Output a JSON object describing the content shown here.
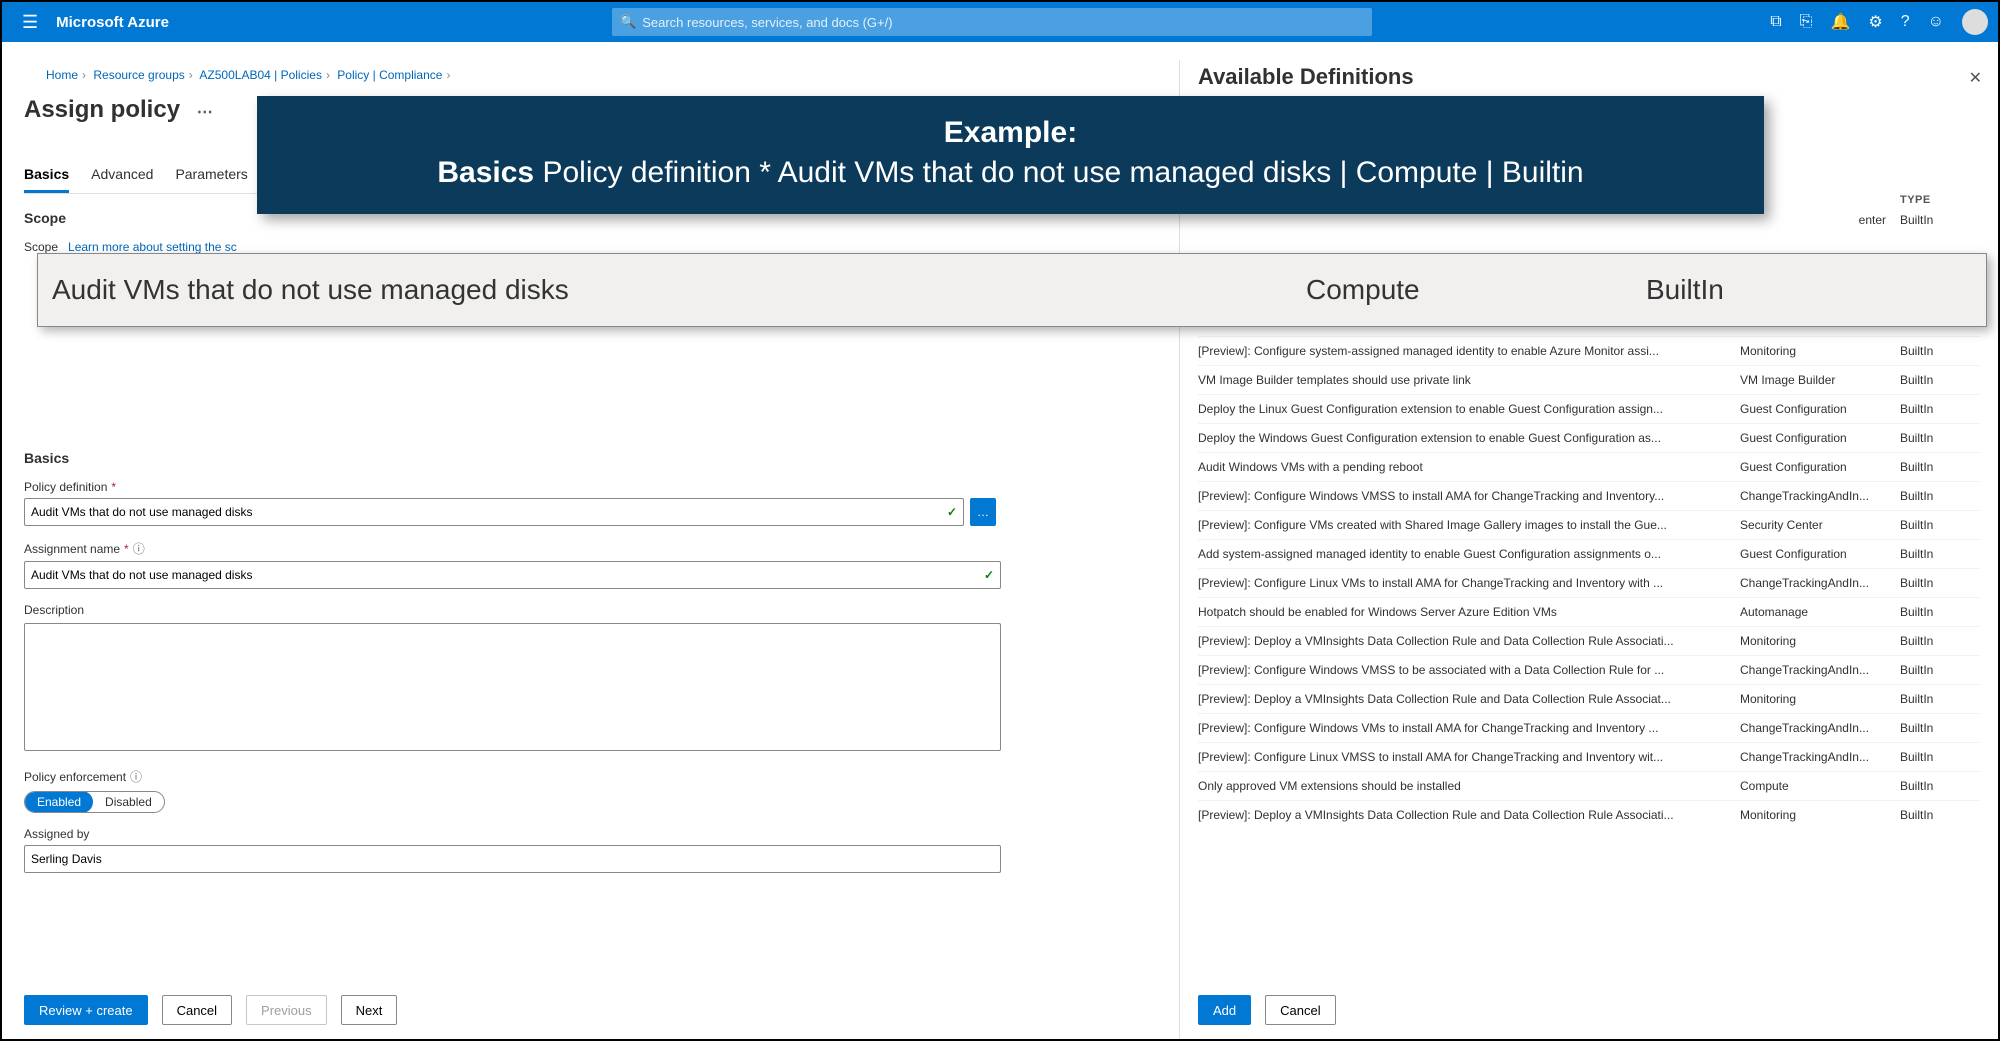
{
  "brand": "Microsoft Azure",
  "search_placeholder": "Search resources, services, and docs (G+/)",
  "breadcrumb": [
    "Home",
    "Resource groups",
    "AZ500LAB04 | Policies",
    "Policy | Compliance"
  ],
  "page_title": "Assign policy",
  "tabs": [
    "Basics",
    "Advanced",
    "Parameters"
  ],
  "scope_section": "Scope",
  "scope_label": "Scope",
  "scope_hint": "Learn more about setting the sc",
  "basics_section": "Basics",
  "policy_def_label": "Policy definition",
  "policy_def_value": "Audit VMs that do not use managed disks",
  "assignment_label": "Assignment name",
  "assignment_value": "Audit VMs that do not use managed disks",
  "description_label": "Description",
  "enforcement_label": "Policy enforcement",
  "toggle": {
    "enabled": "Enabled",
    "disabled": "Disabled"
  },
  "assigned_by_label": "Assigned by",
  "assigned_by_value": "Serling Davis",
  "footer": {
    "review": "Review + create",
    "cancel": "Cancel",
    "previous": "Previous",
    "next": "Next"
  },
  "right": {
    "title": "Available Definitions",
    "col_type": "TYPE",
    "add": "Add",
    "cancel": "Cancel"
  },
  "first_row_truncated": {
    "cat_suffix": "enter",
    "type": "BuiltIn"
  },
  "definitions": [
    {
      "name": "[Preview]: Configure system-assigned managed identity to enable Azure Monitor assi...",
      "category": "Monitoring",
      "type": "BuiltIn"
    },
    {
      "name": "VM Image Builder templates should use private link",
      "category": "VM Image Builder",
      "type": "BuiltIn"
    },
    {
      "name": "Deploy the Linux Guest Configuration extension to enable Guest Configuration assign...",
      "category": "Guest Configuration",
      "type": "BuiltIn"
    },
    {
      "name": "Deploy the Windows Guest Configuration extension to enable Guest Configuration as...",
      "category": "Guest Configuration",
      "type": "BuiltIn"
    },
    {
      "name": "Audit Windows VMs with a pending reboot",
      "category": "Guest Configuration",
      "type": "BuiltIn"
    },
    {
      "name": "[Preview]: Configure Windows VMSS to install AMA for ChangeTracking and Inventory...",
      "category": "ChangeTrackingAndIn...",
      "type": "BuiltIn"
    },
    {
      "name": "[Preview]: Configure VMs created with Shared Image Gallery images to install the Gue...",
      "category": "Security Center",
      "type": "BuiltIn"
    },
    {
      "name": "Add system-assigned managed identity to enable Guest Configuration assignments o...",
      "category": "Guest Configuration",
      "type": "BuiltIn"
    },
    {
      "name": "[Preview]: Configure Linux VMs to install AMA for ChangeTracking and Inventory with ...",
      "category": "ChangeTrackingAndIn...",
      "type": "BuiltIn"
    },
    {
      "name": "Hotpatch should be enabled for Windows Server Azure Edition VMs",
      "category": "Automanage",
      "type": "BuiltIn"
    },
    {
      "name": "[Preview]: Deploy a VMInsights Data Collection Rule and Data Collection Rule Associati...",
      "category": "Monitoring",
      "type": "BuiltIn"
    },
    {
      "name": "[Preview]: Configure Windows VMSS to be associated with a Data Collection Rule for ...",
      "category": "ChangeTrackingAndIn...",
      "type": "BuiltIn"
    },
    {
      "name": "[Preview]: Deploy a VMInsights Data Collection Rule and Data Collection Rule Associat...",
      "category": "Monitoring",
      "type": "BuiltIn"
    },
    {
      "name": "[Preview]: Configure Windows VMs to install AMA for ChangeTracking and Inventory ...",
      "category": "ChangeTrackingAndIn...",
      "type": "BuiltIn"
    },
    {
      "name": "[Preview]: Configure Linux VMSS to install AMA for ChangeTracking and Inventory wit...",
      "category": "ChangeTrackingAndIn...",
      "type": "BuiltIn"
    },
    {
      "name": "Only approved VM extensions should be installed",
      "category": "Compute",
      "type": "BuiltIn"
    },
    {
      "name": "[Preview]: Deploy a VMInsights Data Collection Rule and Data Collection Rule Associati...",
      "category": "Monitoring",
      "type": "BuiltIn"
    }
  ],
  "overlay": {
    "line1": "Example:",
    "line2_bold": "Basics",
    "line2_rest": " Policy definition * Audit VMs that do not use managed disks | Compute | Builtin",
    "row_name": "Audit VMs that do not use managed disks",
    "row_cat": "Compute",
    "row_type": "BuiltIn"
  }
}
